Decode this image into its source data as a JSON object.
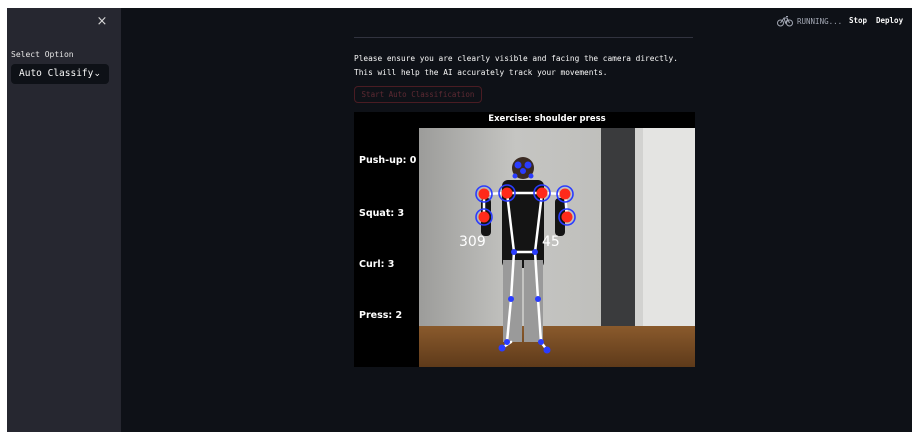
{
  "sidebar": {
    "close_label": "×",
    "select_label": "Select Option",
    "select_value": "Auto Classify",
    "chevron": "⌄"
  },
  "header": {
    "status": "RUNNING...",
    "status_icon": "bike-icon",
    "stop_label": "Stop",
    "deploy_label": "Deploy"
  },
  "main": {
    "instruction_line1": "Please ensure you are clearly visible and facing the camera directly.",
    "instruction_line2": "This will help the AI accurately track your movements.",
    "start_button_label": "Start Auto Classification"
  },
  "video": {
    "exercise_title": "Exercise: shoulder press",
    "counters": [
      {
        "label": "Push-up: 0"
      },
      {
        "label": "Squat: 3"
      },
      {
        "label": "Curl: 3"
      },
      {
        "label": "Press: 2"
      }
    ],
    "angle_left": "309",
    "angle_right": "45"
  },
  "colors": {
    "app_bg": "#0e1117",
    "sidebar_bg": "#262730",
    "joint_red": "#ff2a1a",
    "joint_blue": "#2a3cff",
    "skeleton": "#ffffff"
  }
}
